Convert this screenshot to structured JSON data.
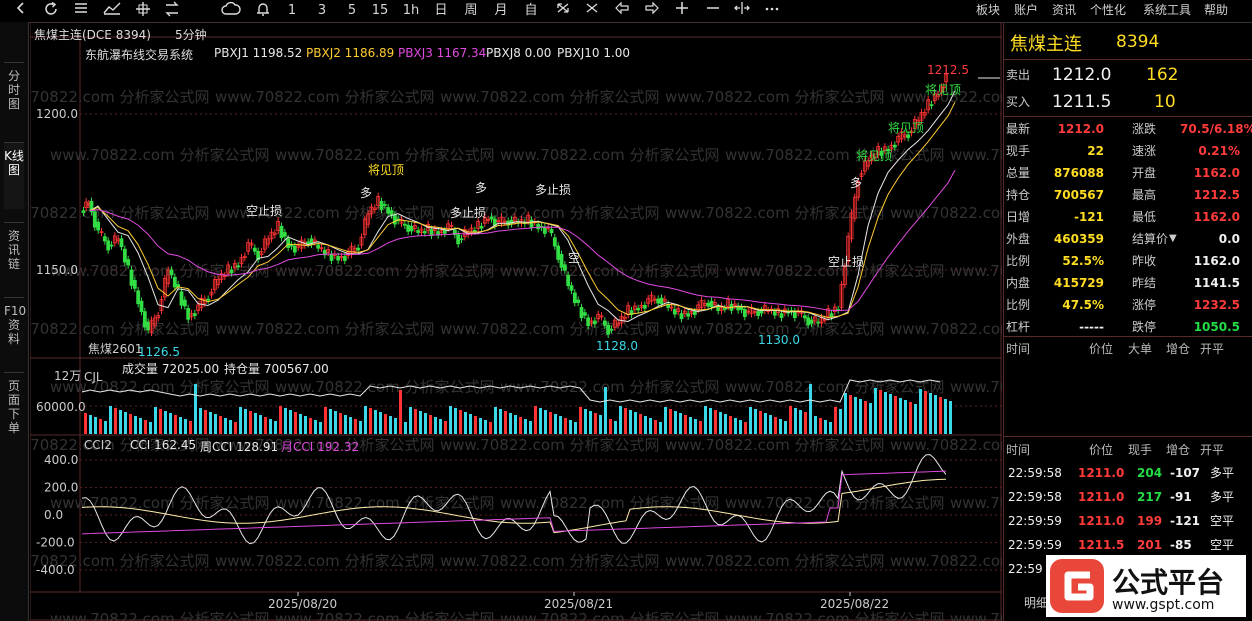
{
  "toolbar": {
    "icons": [
      "back-icon",
      "refresh-icon",
      "menu-icon",
      "line-chart-icon",
      "crosshair-icon",
      "switch-icon",
      "cloud-icon",
      "bell-icon"
    ],
    "periods": [
      "1",
      "3",
      "5",
      "15",
      "1h",
      "日",
      "周",
      "月",
      "自"
    ],
    "menu": [
      "板块",
      "账户",
      "资讯",
      "个性化",
      "系统工具",
      "帮助"
    ]
  },
  "leftbar": {
    "tabs": [
      "分时图",
      "K线图",
      "资讯链",
      "F10资料",
      "页面下单"
    ]
  },
  "chart": {
    "header_title": "焦煤主连(DCE 8394)",
    "period": "5分钟",
    "indicator_name": "东航瀑布线交易系统",
    "pbx": [
      {
        "label": "PBXJ1 1198.52",
        "color": "#e8e8e8"
      },
      {
        "label": "PBXJ2 1186.89",
        "color": "#ffcc33"
      },
      {
        "label": "PBXJ3 1167.34",
        "color": "#e04ae0"
      },
      {
        "label": "PBXJ8 0.00",
        "color": "#e8e8e8"
      },
      {
        "label": "PBXJ10 1.00",
        "color": "#e8e8e8"
      }
    ],
    "price_axis": [
      "1200.0",
      "1150.0"
    ],
    "extremes": {
      "high": "1212.5",
      "low1": "1126.5",
      "low2": "1128.0",
      "low3": "1130.0"
    },
    "contract_label": "焦煤2601",
    "signals": [
      {
        "text": "空止损"
      },
      {
        "text": "将见顶"
      },
      {
        "text": "多"
      },
      {
        "text": "多止损"
      },
      {
        "text": "多"
      },
      {
        "text": "多止损"
      },
      {
        "text": "空"
      },
      {
        "text": "空止损"
      },
      {
        "text": "多"
      },
      {
        "text": "将见顶"
      },
      {
        "text": "将见顶"
      },
      {
        "text": "将见顶"
      }
    ],
    "volume": {
      "title": "CJL",
      "vol_label": "成交量 72025.00",
      "oi_label": "持仓量 700567.00",
      "axis": [
        "12万",
        "60000.0"
      ]
    },
    "cci": {
      "title": "CCI2",
      "cci": "CCI 162.45",
      "wcci": "周CCI 128.91",
      "mcci": "月CCI 192.32",
      "axis": [
        "400.0",
        "200.0",
        "0.0",
        "-200.0",
        "-400.0"
      ]
    },
    "dates": [
      "2025/08/20",
      "2025/08/21",
      "2025/08/22"
    ],
    "watermark": "www.70822.com 分析家公式网"
  },
  "quote": {
    "name": "焦煤主连",
    "code": "8394",
    "sell": {
      "label": "卖出",
      "price": "1212.0",
      "qty": "162"
    },
    "buy": {
      "label": "买入",
      "price": "1211.5",
      "qty": "10"
    },
    "rows": [
      {
        "k": "最新",
        "v": "1212.0",
        "vc": "red",
        "k2": "涨跌",
        "v2": "70.5/6.18%",
        "v2c": "red"
      },
      {
        "k": "现手",
        "v": "22",
        "vc": "yellow",
        "k2": "速涨",
        "v2": "0.21%",
        "v2c": "red"
      },
      {
        "k": "总量",
        "v": "876088",
        "vc": "yellow",
        "k2": "开盘",
        "v2": "1162.0",
        "v2c": "red"
      },
      {
        "k": "持仓",
        "v": "700567",
        "vc": "yellow",
        "k2": "最高",
        "v2": "1212.5",
        "v2c": "red"
      },
      {
        "k": "日增",
        "v": "-121",
        "vc": "yellow",
        "k2": "最低",
        "v2": "1162.0",
        "v2c": "red"
      },
      {
        "k": "外盘",
        "v": "460359",
        "vc": "yellow",
        "k2": "结算价",
        "v2": "0.0",
        "v2c": "white"
      },
      {
        "k": "比例",
        "v": "52.5%",
        "vc": "yellow",
        "k2": "昨收",
        "v2": "1162.0",
        "v2c": "white"
      },
      {
        "k": "内盘",
        "v": "415729",
        "vc": "yellow",
        "k2": "昨结",
        "v2": "1141.5",
        "v2c": "white"
      },
      {
        "k": "比例",
        "v": "47.5%",
        "vc": "yellow",
        "k2": "涨停",
        "v2": "1232.5",
        "v2c": "red"
      },
      {
        "k": "杠杆",
        "v": "-----",
        "vc": "white",
        "k2": "跌停",
        "v2": "1050.5",
        "v2c": "green"
      }
    ],
    "tick_header1": [
      "时间",
      "价位",
      "大单",
      "增仓",
      "开平"
    ],
    "tick_header2": [
      "时间",
      "价位",
      "现手",
      "增仓",
      "开平"
    ],
    "ticks": [
      {
        "time": "22:59:58",
        "price": "1211.0",
        "qty": "204",
        "qc": "green",
        "oi": "-107",
        "type": "多平"
      },
      {
        "time": "22:59:58",
        "price": "1211.0",
        "qty": "217",
        "qc": "green",
        "oi": "-91",
        "type": "多平"
      },
      {
        "time": "22:59:59",
        "price": "1211.0",
        "qty": "199",
        "qc": "red",
        "oi": "-121",
        "type": "空平"
      },
      {
        "time": "22:59:59",
        "price": "1211.5",
        "qty": "201",
        "qc": "red",
        "oi": "-85",
        "type": "空平"
      },
      {
        "time": "22:59",
        "price": "",
        "qty": "",
        "qc": "white",
        "oi": "",
        "type": ""
      }
    ],
    "detail_tab": "明细"
  },
  "logo": {
    "text": "公式平台",
    "url": "www.gspt.com"
  }
}
